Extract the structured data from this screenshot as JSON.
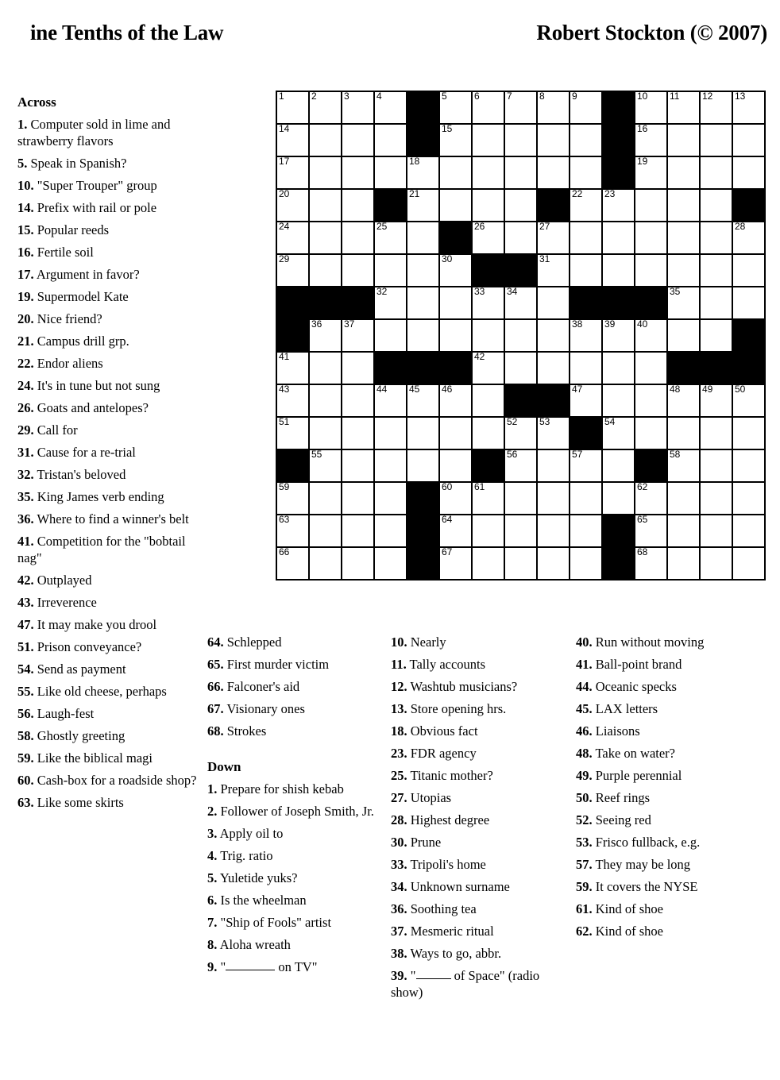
{
  "header": {
    "title": "ine Tenths of the Law",
    "author": "Robert Stockton (© 2007)"
  },
  "labels": {
    "across": "Across",
    "down": "Down"
  },
  "grid": {
    "cols": 15,
    "rows": 15,
    "cell_size_px": 41,
    "black_color": "#000000",
    "white_color": "#ffffff",
    "rows_pattern": [
      "WWWW.WWWWW.WWWW",
      "WWWW.WWWWW.WWWW",
      "WWWWWWWWWW.WWWW",
      "WWW.WWWW.WWWWW.",
      "WWWWW.WWWWWWWWW",
      "WWWWWW..WWWWWWW",
      "...WWWWWW...WWW",
      ".WWWWWWWWWWWWW.",
      "WWW...WWWWWW...",
      "WWWWWWW..WWWWWW",
      "WWWWWWWWW.WWWWW",
      ".WWWWW.WWWW.WWW",
      "WWWW.WWWWWWWWWW",
      "WWWW.WWWWW.WWWW",
      "WWWW.WWWWW.WWWW"
    ],
    "numbers": [
      {
        "r": 0,
        "c": 0,
        "n": "1"
      },
      {
        "r": 0,
        "c": 1,
        "n": "2"
      },
      {
        "r": 0,
        "c": 2,
        "n": "3"
      },
      {
        "r": 0,
        "c": 3,
        "n": "4"
      },
      {
        "r": 0,
        "c": 5,
        "n": "5"
      },
      {
        "r": 0,
        "c": 6,
        "n": "6"
      },
      {
        "r": 0,
        "c": 7,
        "n": "7"
      },
      {
        "r": 0,
        "c": 8,
        "n": "8"
      },
      {
        "r": 0,
        "c": 9,
        "n": "9"
      },
      {
        "r": 0,
        "c": 11,
        "n": "10"
      },
      {
        "r": 0,
        "c": 12,
        "n": "11"
      },
      {
        "r": 0,
        "c": 13,
        "n": "12"
      },
      {
        "r": 0,
        "c": 14,
        "n": "13"
      },
      {
        "r": 1,
        "c": 0,
        "n": "14"
      },
      {
        "r": 1,
        "c": 5,
        "n": "15"
      },
      {
        "r": 1,
        "c": 11,
        "n": "16"
      },
      {
        "r": 2,
        "c": 0,
        "n": "17"
      },
      {
        "r": 2,
        "c": 4,
        "n": "18"
      },
      {
        "r": 2,
        "c": 11,
        "n": "19"
      },
      {
        "r": 3,
        "c": 0,
        "n": "20"
      },
      {
        "r": 3,
        "c": 4,
        "n": "21"
      },
      {
        "r": 3,
        "c": 9,
        "n": "22"
      },
      {
        "r": 3,
        "c": 10,
        "n": "23"
      },
      {
        "r": 4,
        "c": 0,
        "n": "24"
      },
      {
        "r": 4,
        "c": 3,
        "n": "25"
      },
      {
        "r": 4,
        "c": 6,
        "n": "26"
      },
      {
        "r": 4,
        "c": 8,
        "n": "27"
      },
      {
        "r": 4,
        "c": 14,
        "n": "28"
      },
      {
        "r": 5,
        "c": 0,
        "n": "29"
      },
      {
        "r": 5,
        "c": 5,
        "n": "30"
      },
      {
        "r": 5,
        "c": 8,
        "n": "31"
      },
      {
        "r": 6,
        "c": 3,
        "n": "32"
      },
      {
        "r": 6,
        "c": 6,
        "n": "33"
      },
      {
        "r": 6,
        "c": 7,
        "n": "34"
      },
      {
        "r": 6,
        "c": 12,
        "n": "35"
      },
      {
        "r": 7,
        "c": 1,
        "n": "36"
      },
      {
        "r": 7,
        "c": 2,
        "n": "37"
      },
      {
        "r": 7,
        "c": 9,
        "n": "38"
      },
      {
        "r": 7,
        "c": 10,
        "n": "39"
      },
      {
        "r": 7,
        "c": 11,
        "n": "40"
      },
      {
        "r": 8,
        "c": 0,
        "n": "41"
      },
      {
        "r": 8,
        "c": 6,
        "n": "42"
      },
      {
        "r": 9,
        "c": 0,
        "n": "43"
      },
      {
        "r": 9,
        "c": 3,
        "n": "44"
      },
      {
        "r": 9,
        "c": 4,
        "n": "45"
      },
      {
        "r": 9,
        "c": 5,
        "n": "46"
      },
      {
        "r": 9,
        "c": 9,
        "n": "47"
      },
      {
        "r": 9,
        "c": 12,
        "n": "48"
      },
      {
        "r": 9,
        "c": 13,
        "n": "49"
      },
      {
        "r": 9,
        "c": 14,
        "n": "50"
      },
      {
        "r": 10,
        "c": 0,
        "n": "51"
      },
      {
        "r": 10,
        "c": 7,
        "n": "52"
      },
      {
        "r": 10,
        "c": 8,
        "n": "53"
      },
      {
        "r": 10,
        "c": 10,
        "n": "54"
      },
      {
        "r": 11,
        "c": 1,
        "n": "55"
      },
      {
        "r": 11,
        "c": 7,
        "n": "56"
      },
      {
        "r": 11,
        "c": 9,
        "n": "57"
      },
      {
        "r": 11,
        "c": 12,
        "n": "58"
      },
      {
        "r": 12,
        "c": 0,
        "n": "59"
      },
      {
        "r": 12,
        "c": 5,
        "n": "60"
      },
      {
        "r": 12,
        "c": 6,
        "n": "61"
      },
      {
        "r": 12,
        "c": 11,
        "n": "62"
      },
      {
        "r": 13,
        "c": 0,
        "n": "63"
      },
      {
        "r": 13,
        "c": 5,
        "n": "64"
      },
      {
        "r": 13,
        "c": 11,
        "n": "65"
      },
      {
        "r": 14,
        "c": 0,
        "n": "66"
      },
      {
        "r": 14,
        "c": 5,
        "n": "67"
      },
      {
        "r": 14,
        "c": 11,
        "n": "68"
      }
    ]
  },
  "clues": {
    "across_col1": [
      {
        "num": "1.",
        "text": "Computer sold in lime and strawberry flavors"
      },
      {
        "num": "5.",
        "text": "Speak in Spanish?"
      },
      {
        "num": "10.",
        "text": "\"Super Trouper\" group"
      },
      {
        "num": "14.",
        "text": "Prefix with rail or pole"
      },
      {
        "num": "15.",
        "text": "Popular reeds"
      },
      {
        "num": "16.",
        "text": "Fertile soil"
      },
      {
        "num": "17.",
        "text": "Argument in favor?"
      },
      {
        "num": "19.",
        "text": "Supermodel Kate"
      },
      {
        "num": "20.",
        "text": "Nice friend?"
      },
      {
        "num": "21.",
        "text": "Campus drill grp."
      },
      {
        "num": "22.",
        "text": "Endor aliens"
      },
      {
        "num": "24.",
        "text": "It's in tune but not sung"
      },
      {
        "num": "26.",
        "text": "Goats and antelopes?"
      },
      {
        "num": "29.",
        "text": "Call for"
      },
      {
        "num": "31.",
        "text": "Cause for a re-trial"
      },
      {
        "num": "32.",
        "text": "Tristan's beloved"
      },
      {
        "num": "35.",
        "text": "King James verb ending"
      },
      {
        "num": "36.",
        "text": "Where to find a winner's belt"
      },
      {
        "num": "41.",
        "text": "Competition for the \"bobtail nag\""
      },
      {
        "num": "42.",
        "text": "Outplayed"
      },
      {
        "num": "43.",
        "text": "Irreverence"
      },
      {
        "num": "47.",
        "text": "It may make you drool"
      },
      {
        "num": "51.",
        "text": "Prison conveyance?"
      },
      {
        "num": "54.",
        "text": "Send as payment"
      },
      {
        "num": "55.",
        "text": "Like old cheese, perhaps"
      },
      {
        "num": "56.",
        "text": "Laugh-fest"
      },
      {
        "num": "58.",
        "text": "Ghostly greeting"
      },
      {
        "num": "59.",
        "text": "Like the biblical magi"
      },
      {
        "num": "60.",
        "text": "Cash-box for a roadside shop?"
      },
      {
        "num": "63.",
        "text": "Like some skirts"
      }
    ],
    "across_col2": [
      {
        "num": "64.",
        "text": "Schlepped"
      },
      {
        "num": "65.",
        "text": "First murder victim"
      },
      {
        "num": "66.",
        "text": "Falconer's aid"
      },
      {
        "num": "67.",
        "text": "Visionary ones"
      },
      {
        "num": "68.",
        "text": "Strokes"
      }
    ],
    "down_col2": [
      {
        "num": "1.",
        "text": "Prepare for shish kebab"
      },
      {
        "num": "2.",
        "text": "Follower of Joseph Smith, Jr."
      },
      {
        "num": "3.",
        "text": "Apply oil to"
      },
      {
        "num": "4.",
        "text": "Trig. ratio"
      },
      {
        "num": "5.",
        "text": "Yuletide yuks?"
      },
      {
        "num": "6.",
        "text": "Is the wheelman"
      },
      {
        "num": "7.",
        "text": "\"Ship of Fools\" artist"
      },
      {
        "num": "8.",
        "text": "Aloha wreath"
      }
    ],
    "down_col2_blank": {
      "num": "9.",
      "pre": "\"",
      "post": " on TV\""
    },
    "down_col3": [
      {
        "num": "10.",
        "text": "Nearly"
      },
      {
        "num": "11.",
        "text": "Tally accounts"
      },
      {
        "num": "12.",
        "text": "Washtub musicians?"
      },
      {
        "num": "13.",
        "text": "Store opening hrs."
      },
      {
        "num": "18.",
        "text": "Obvious fact"
      },
      {
        "num": "23.",
        "text": "FDR agency"
      },
      {
        "num": "25.",
        "text": "Titanic mother?"
      },
      {
        "num": "27.",
        "text": "Utopias"
      },
      {
        "num": "28.",
        "text": "Highest degree"
      },
      {
        "num": "30.",
        "text": "Prune"
      },
      {
        "num": "33.",
        "text": "Tripoli's home"
      },
      {
        "num": "34.",
        "text": "Unknown surname"
      },
      {
        "num": "36.",
        "text": "Soothing tea"
      },
      {
        "num": "37.",
        "text": "Mesmeric ritual"
      },
      {
        "num": "38.",
        "text": "Ways to go, abbr."
      }
    ],
    "down_col3_blank": {
      "num": "39.",
      "pre": "\"",
      "post": " of Space\" (radio show)"
    },
    "down_col4": [
      {
        "num": "40.",
        "text": "Run without moving"
      },
      {
        "num": "41.",
        "text": "Ball-point brand"
      },
      {
        "num": "44.",
        "text": "Oceanic specks"
      },
      {
        "num": "45.",
        "text": "LAX letters"
      },
      {
        "num": "46.",
        "text": "Liaisons"
      },
      {
        "num": "48.",
        "text": "Take on water?"
      },
      {
        "num": "49.",
        "text": "Purple perennial"
      },
      {
        "num": "50.",
        "text": "Reef rings"
      },
      {
        "num": "52.",
        "text": "Seeing red"
      },
      {
        "num": "53.",
        "text": "Frisco fullback, e.g."
      },
      {
        "num": "57.",
        "text": "They may be long"
      },
      {
        "num": "59.",
        "text": "It covers the NYSE"
      },
      {
        "num": "61.",
        "text": "Kind of shoe"
      },
      {
        "num": "62.",
        "text": "Kind of shoe"
      }
    ]
  }
}
